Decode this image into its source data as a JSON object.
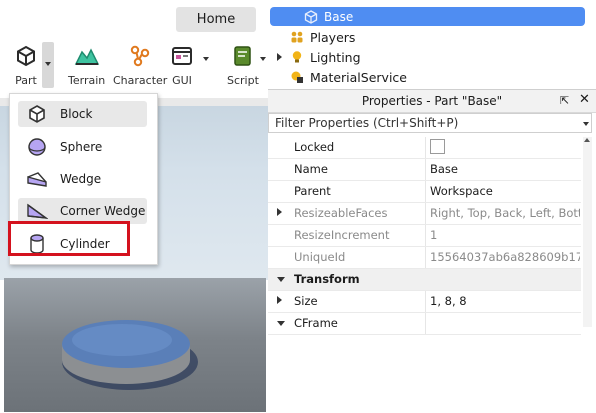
{
  "ribbon": {
    "home_tab": "Home",
    "tools": [
      {
        "label": "Part"
      },
      {
        "label": "Terrain"
      },
      {
        "label": "Character"
      },
      {
        "label": "GUI"
      },
      {
        "label": "Script"
      }
    ]
  },
  "part_menu": {
    "items": [
      {
        "label": "Block",
        "icon": "block-icon"
      },
      {
        "label": "Sphere",
        "icon": "sphere-icon"
      },
      {
        "label": "Wedge",
        "icon": "wedge-icon"
      },
      {
        "label": "Corner Wedge",
        "icon": "corner-wedge-icon"
      },
      {
        "label": "Cylinder",
        "icon": "cylinder-icon"
      }
    ],
    "highlight_color": "#d4121e"
  },
  "explorer": {
    "selected_item": "Base",
    "items": [
      "Players",
      "Lighting",
      "MaterialService"
    ],
    "selection_color": "#4f8df2"
  },
  "properties": {
    "title": "Properties - Part \"Base\"",
    "filter_placeholder": "Filter Properties (Ctrl+Shift+P)",
    "rows": [
      {
        "name": "Locked",
        "value": ""
      },
      {
        "name": "Name",
        "value": "Base"
      },
      {
        "name": "Parent",
        "value": "Workspace"
      },
      {
        "name": "ResizeableFaces",
        "value": "Right, Top, Back, Left, Bott..."
      },
      {
        "name": "ResizeIncrement",
        "value": "1"
      },
      {
        "name": "UniqueId",
        "value": "15564037ab6a828609b170..."
      }
    ],
    "section": "Transform",
    "transform_rows": [
      {
        "name": "Size",
        "value": "1, 8, 8"
      },
      {
        "name": "CFrame",
        "value": ""
      }
    ]
  }
}
